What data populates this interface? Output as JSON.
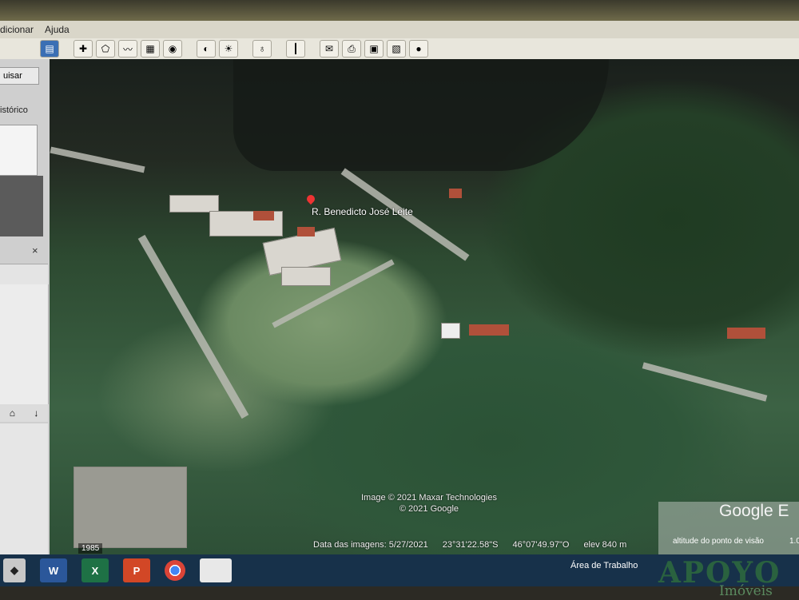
{
  "menu": {
    "items": [
      "dicionar",
      "Ajuda"
    ]
  },
  "toolbar": {
    "icons": [
      "sidebar-toggle-icon",
      "placemark-icon",
      "polygon-icon",
      "path-icon",
      "overlay-icon",
      "tour-icon",
      "earth-icon",
      "sun-icon",
      "planet-icon",
      "ruler-icon",
      "email-icon",
      "print-icon",
      "save-image-icon",
      "maps-icon",
      "globe-icon"
    ]
  },
  "sidebar": {
    "search_label": "uisar",
    "history_label": "istórico",
    "close_symbol": "×",
    "up_arrow": "⌂",
    "down_arrow": "↓"
  },
  "map": {
    "place_label": "R. Benedicto José Leite",
    "credit_line1": "Image © 2021 Maxar Technologies",
    "credit_line2": "© 2021 Google",
    "history_year": "1985"
  },
  "status": {
    "imagery_date": "Data das imagens: 5/27/2021",
    "latitude": "23°31'22.58\"S",
    "longitude": "46°07'49.97\"O",
    "elevation": "elev   840 m",
    "altitude_label": "altitude do ponto de visão",
    "altitude_value": "1.0",
    "google_logo": "Google E"
  },
  "taskbar": {
    "desktop_label": "Área de Trabalho"
  },
  "watermark": {
    "brand": "APOYO",
    "sub": "Imóveis"
  }
}
